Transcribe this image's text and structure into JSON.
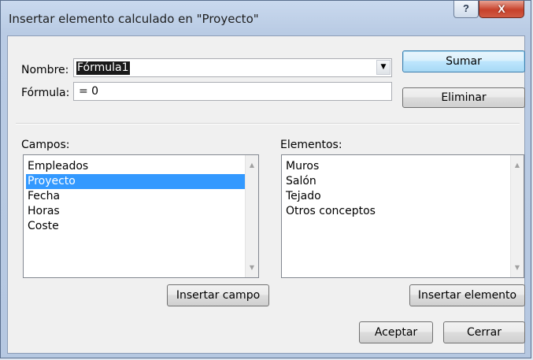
{
  "window": {
    "title": "Insertar elemento calculado en \"Proyecto\"",
    "help_glyph": "?",
    "close_glyph": "X"
  },
  "form": {
    "name_label": "Nombre:",
    "name_value": "Fórmula1",
    "formula_label": "Fórmula:",
    "formula_value": "= 0"
  },
  "buttons": {
    "add": "Sumar",
    "delete": "Eliminar",
    "insert_field": "Insertar campo",
    "insert_item": "Insertar elemento",
    "ok": "Aceptar",
    "cancel": "Cerrar"
  },
  "fields": {
    "label": "Campos:",
    "items": [
      "Empleados",
      "Proyecto",
      "Fecha",
      "Horas",
      "Coste"
    ],
    "selected": "Proyecto"
  },
  "elements": {
    "label": "Elementos:",
    "items": [
      "Muros",
      "Salón",
      "Tejado",
      "Otros conceptos"
    ]
  },
  "icons": {
    "dropdown": "chevron-down-icon",
    "scroll_up": "arrow-up-icon",
    "scroll_down": "arrow-down-icon"
  },
  "colors": {
    "selection": "#3399ff",
    "close_button": "#c7412b",
    "title_bar": "#c9d9ee"
  }
}
